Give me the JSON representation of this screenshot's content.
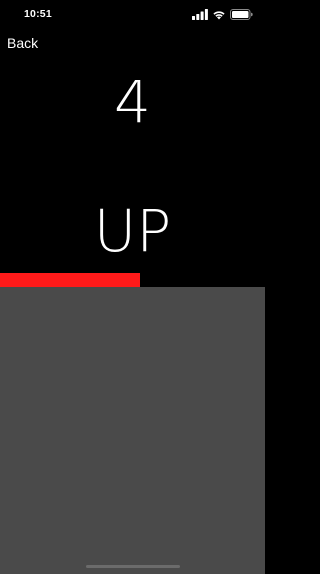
{
  "status_bar": {
    "time": "10:51",
    "icons": [
      "cellular-signal-icon",
      "wifi-icon",
      "battery-icon"
    ]
  },
  "nav": {
    "back_label": "Back"
  },
  "display": {
    "count": "4",
    "direction": "UP"
  },
  "progress": {
    "fraction": 0.53,
    "color": "#ff1a1a"
  },
  "colors": {
    "background": "#000000",
    "lower_panel": "#4a4a4a",
    "text": "#ffffff"
  }
}
